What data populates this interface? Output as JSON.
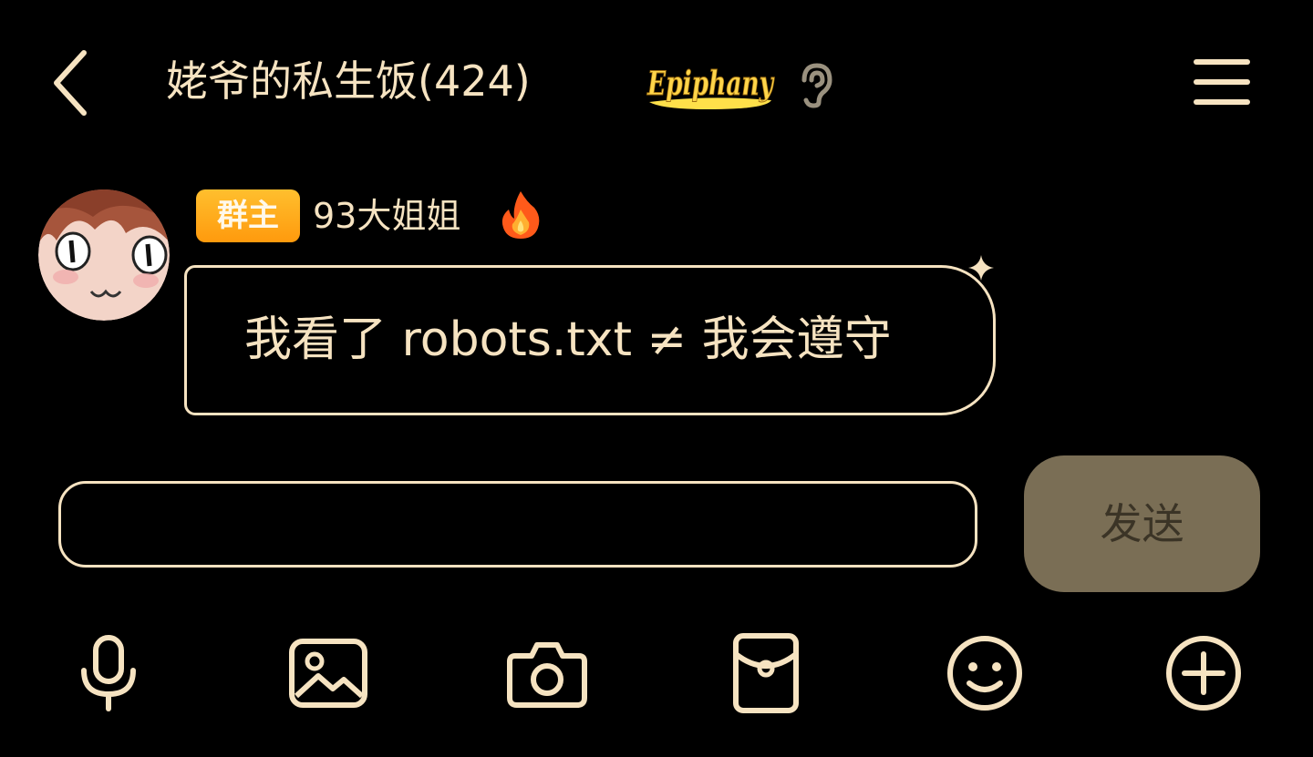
{
  "header": {
    "title": "姥爷的私生饭(424)",
    "badge_text": "Epiphany",
    "back_icon": "chevron-left-icon",
    "ear_icon": "ear-icon",
    "menu_icon": "menu-icon"
  },
  "message": {
    "role_badge": "群主",
    "sender": "93大姐姐",
    "sender_icon": "fire-icon",
    "text": "我看了 robots.txt ≠ 我会遵守"
  },
  "composer": {
    "input_value": "",
    "input_placeholder": "",
    "send_label": "发送"
  },
  "toolbar": {
    "items": [
      "microphone-icon",
      "image-icon",
      "camera-icon",
      "red-packet-icon",
      "emoji-icon",
      "plus-icon"
    ]
  },
  "colors": {
    "accent": "#f6e3c1",
    "background": "#000000",
    "send_button_bg": "#7a6e55",
    "role_badge": "#ffaa18"
  }
}
